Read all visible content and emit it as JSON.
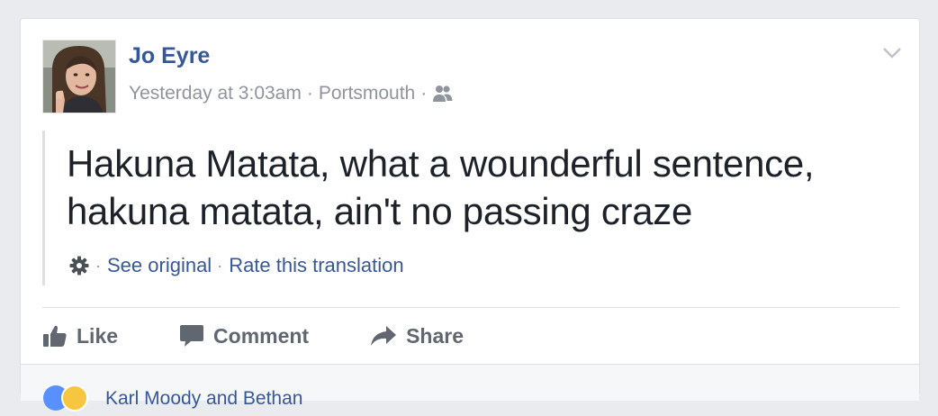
{
  "post": {
    "author": "Jo Eyre",
    "timestamp": "Yesterday at 3:03am",
    "location": "Portsmouth",
    "separator": "·",
    "audience_icon": "friends-icon",
    "options_icon": "chevron-down-icon",
    "text_line1": "Hakuna Matata, what a wounderful sentence,",
    "text_line2": "hakuna matata, ain't no passing craze"
  },
  "translation": {
    "settings_icon": "gear-icon",
    "see_original": "See original",
    "rate": "Rate this translation"
  },
  "actions": {
    "like": "Like",
    "comment": "Comment",
    "share": "Share"
  },
  "footer": {
    "reactors": "Karl Moody and Bethan",
    "reaction_icons": [
      "like-reaction-icon",
      "haha-reaction-icon"
    ]
  },
  "colors": {
    "link": "#365899",
    "meta": "#90949c",
    "text": "#1d2129",
    "action": "#606770",
    "background": "#e9ebee"
  }
}
